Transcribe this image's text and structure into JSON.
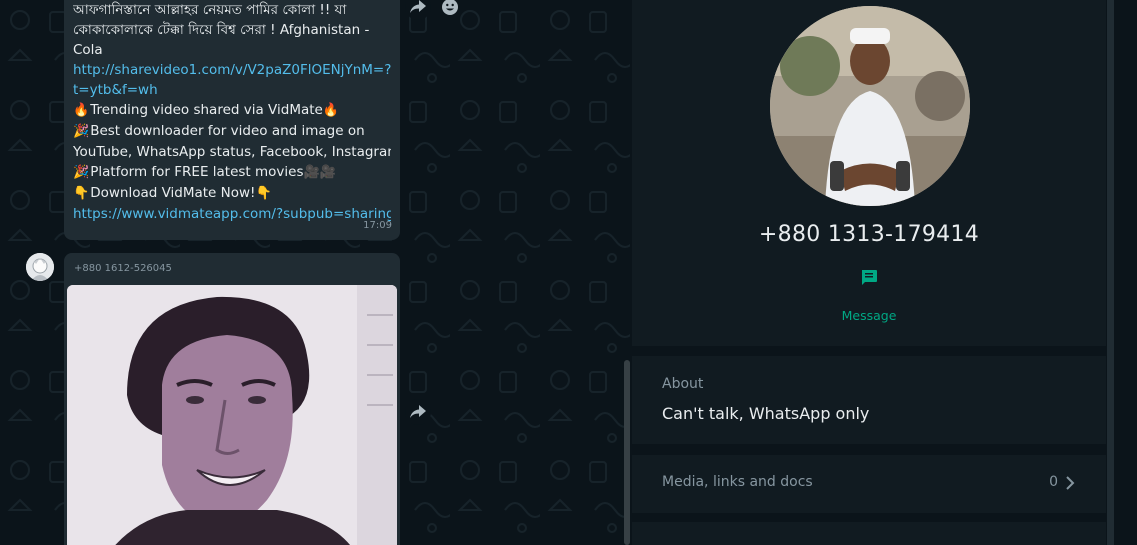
{
  "chat": {
    "message1": {
      "lines": [
        "আফগানিস্তানে আল্লাহর নেয়মত পামির কোলা !! যা",
        "কোকাকোলাকে টেক্কা দিয়ে বিশ্ব সেরা ! Afghanistan -",
        "Cola"
      ],
      "link1_a": "http://sharevideo1.com/v/V2paZ0FlOENjYnM=?",
      "link1_b": "t=ytb&f=wh",
      "trending": "Trending video shared via VidMate",
      "best_a": "Best downloader for video and image on",
      "best_b": "YouTube, WhatsApp status, Facebook, Instagram...",
      "platform": "Platform for FREE latest movies",
      "download": "Download VidMate Now!",
      "link2": "https://www.vidmateapp.com/?subpub=sharing",
      "time": "17:09",
      "emoji_fire": "🔥",
      "emoji_party": "🎉",
      "emoji_camera": "🎥🎥",
      "emoji_point": "👇"
    },
    "message2": {
      "sender": "+880 1612-526045"
    }
  },
  "contact": {
    "phone": "+880 1313-179414",
    "message_label": "Message",
    "about_title": "About",
    "about_text": "Can't talk, WhatsApp only",
    "media_label": "Media, links and docs",
    "media_count": "0"
  },
  "colors": {
    "accent": "#00a884",
    "link": "#53bdeb",
    "bubble": "#202c33",
    "panel": "#111b21",
    "background": "#0b141a"
  },
  "icons": [
    "forward-icon",
    "emoji-icon",
    "message-icon",
    "chevron-right-icon"
  ]
}
